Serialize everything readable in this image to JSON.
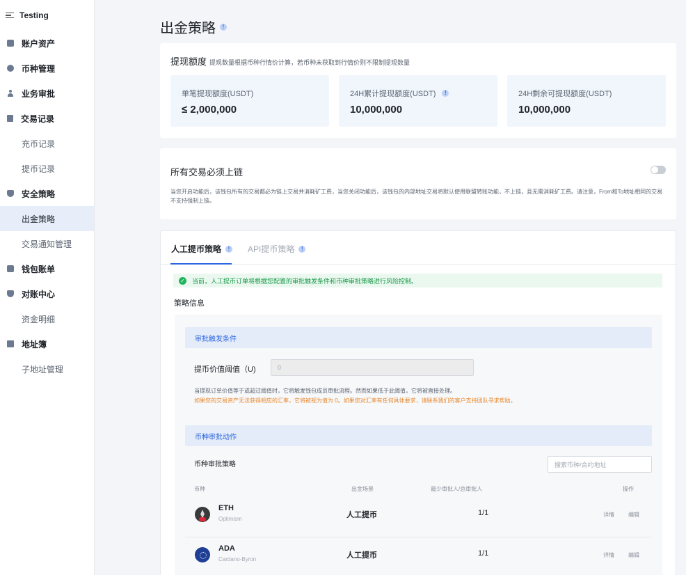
{
  "sidebar": {
    "brand": "Testing",
    "items": [
      {
        "label": "账户资产",
        "icon": "wallet-icon",
        "type": "group"
      },
      {
        "label": "币种管理",
        "icon": "coin-icon",
        "type": "group"
      },
      {
        "label": "业务审批",
        "icon": "user-icon",
        "type": "group"
      },
      {
        "label": "交易记录",
        "icon": "document-icon",
        "type": "group"
      },
      {
        "label": "充币记录",
        "type": "sub"
      },
      {
        "label": "提币记录",
        "type": "sub"
      },
      {
        "label": "安全策略",
        "icon": "shield-icon",
        "type": "group"
      },
      {
        "label": "出金策略",
        "type": "sub",
        "active": true
      },
      {
        "label": "交易通知管理",
        "type": "sub"
      },
      {
        "label": "钱包账单",
        "icon": "wallet-icon",
        "type": "group"
      },
      {
        "label": "对账中心",
        "icon": "shield-icon",
        "type": "group"
      },
      {
        "label": "资金明细",
        "type": "sub"
      },
      {
        "label": "地址簿",
        "icon": "book-icon",
        "type": "group"
      },
      {
        "label": "子地址管理",
        "type": "sub"
      }
    ]
  },
  "page": {
    "title": "出金策略"
  },
  "withdraw_limit": {
    "title": "提现额度",
    "subtitle": "提现数量根据币种行情价计算，若币种未获取到行情价则不限制提现数量",
    "stats": [
      {
        "label": "单笔提现额度(USDT)",
        "value": "≤ 2,000,000"
      },
      {
        "label": "24H累计提现额度(USDT)",
        "value": "10,000,000"
      },
      {
        "label": "24H剩余可提现额度(USDT)",
        "value": "10,000,000"
      }
    ]
  },
  "onchain": {
    "title": "所有交易必须上链",
    "desc": "当您开启功能后，该钱包所有的交易都必为链上交易并消耗矿工费，当您关闭功能后，该钱包的内部地址交易将默认使用联盟转账功能，不上链，且无需消耗矿工费。请注意，From和To地址相同的交易不支持强制上链。",
    "enabled": false
  },
  "policy": {
    "tabs": [
      "人工提币策略",
      "API提币策略"
    ],
    "notice": "当前，人工提币订单将根据您配置的审批触发条件和币种审批策略进行风险控制。",
    "section_label": "策略信息",
    "trigger_title": "审批触发条件",
    "threshold_label": "提币价值阈值（U)",
    "threshold_value": "0",
    "hint": "当提现订单价值等于或超过阈值时，它将触发钱包成员审批流程。然而如果低于此阈值，它将被直接处理。",
    "warning": "如果您的交易资产无法获得相应的汇率，它将被视为值为 0。如果您对汇率有任何具体要求，请联系我们的客户支持团队寻求帮助。",
    "action_title": "币种审批动作",
    "strategy_label": "币种审批策略",
    "search_placeholder": "搜索币种/合约地址",
    "columns": [
      "币种",
      "出金场景",
      "最少审批人/总审批人",
      "操作"
    ],
    "rows": [
      {
        "coin": "ETH",
        "network": "Optimism",
        "scene": "人工提币",
        "ratio": "1/1",
        "detail": "详情",
        "edit": "编辑"
      },
      {
        "coin": "ADA",
        "network": "Cardano-Byron",
        "scene": "人工提币",
        "ratio": "1/1",
        "detail": "详情",
        "edit": "编辑"
      }
    ]
  },
  "colors": {
    "accent": "#2b66e0",
    "success": "#22b35e",
    "warning": "#e8872b"
  }
}
